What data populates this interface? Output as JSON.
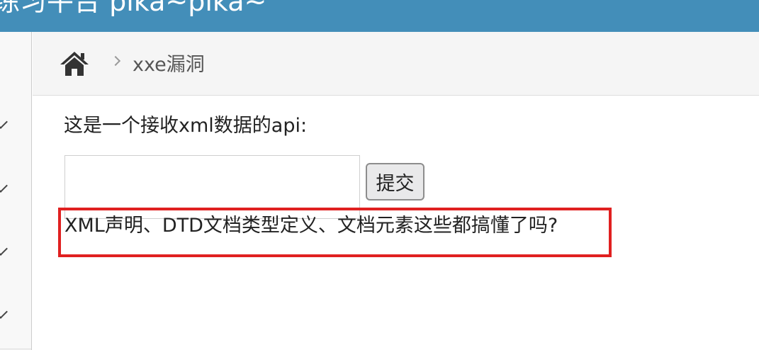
{
  "header": {
    "title": "练习平台 pika~pika~"
  },
  "breadcrumb": {
    "home_icon": "home-icon",
    "separator_icon": "chevron-right-icon",
    "current": "xxe漏洞"
  },
  "main": {
    "api_label": "这是一个接收xml数据的api:",
    "input_value": "",
    "submit_label": "提交",
    "note": "XML声明、DTD文档类型定义、文档元素这些都搞懂了吗?"
  },
  "sidebar": {
    "items_icon": "chevron-down-icon"
  },
  "colors": {
    "topbar": "#438eb9",
    "highlight": "#e02020"
  }
}
